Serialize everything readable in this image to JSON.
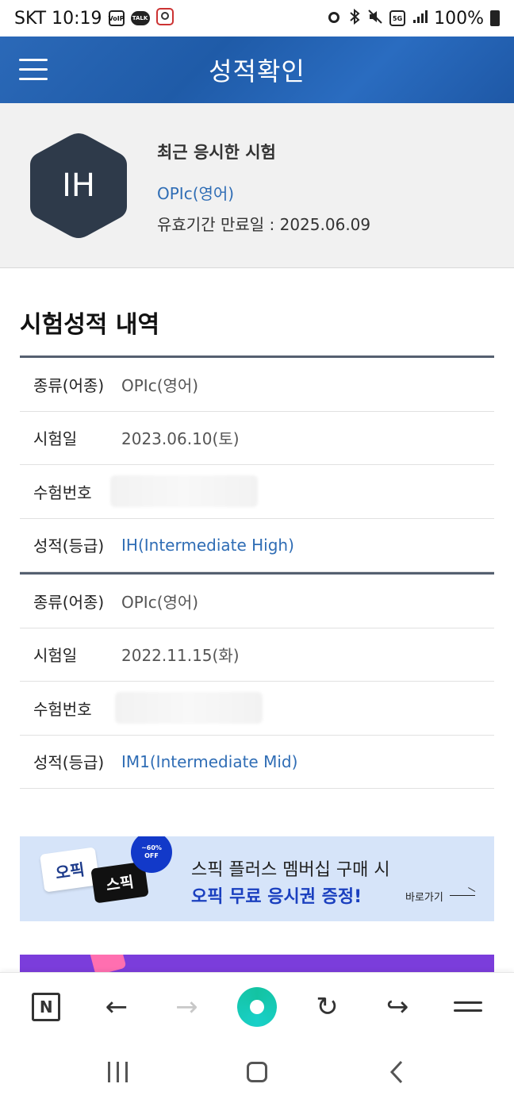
{
  "status_bar": {
    "carrier_time": "SKT 10:19",
    "icons": [
      "voip-icon",
      "talk-icon",
      "location-app-icon",
      "alarm-icon",
      "bluetooth-icon",
      "mute-icon",
      "5g-icon",
      "signal-icon",
      "battery-icon"
    ],
    "voip_label": "VoIP",
    "talk_label": "TALK",
    "network": "5G",
    "battery": "100%"
  },
  "header": {
    "title": "성적확인"
  },
  "profile": {
    "grade_badge": "IH",
    "recent_title": "최근 응시한 시험",
    "recent_exam": "OPIc(영어)",
    "expiry": "유효기간 만료일 : 2025.06.09",
    "badge_color": "#2e3a4a"
  },
  "records_section": {
    "title": "시험성적 내역",
    "records": [
      {
        "type_label": "종류(어종)",
        "type_value": "OPIc(영어)",
        "date_label": "시험일",
        "date_value": "2023.06.10(토)",
        "number_label": "수험번호",
        "grade_label": "성적(등급)",
        "grade_value": "IH(Intermediate High)"
      },
      {
        "type_label": "종류(어종)",
        "type_value": "OPIc(영어)",
        "date_label": "시험일",
        "date_value": "2022.11.15(화)",
        "number_label": "수험번호",
        "grade_label": "성적(등급)",
        "grade_value": "IM1(Intermediate Mid)"
      }
    ]
  },
  "banner": {
    "card1": "오픽",
    "card2": "스픽",
    "badge_top": "~60%",
    "badge_bottom": "OFF",
    "line1": "스픽 플러스 멤버십 구매 시",
    "line2": "오픽 무료 응시권 증정!",
    "link": "바로가기"
  },
  "browser_bar": {
    "home_label": "N",
    "back": "←",
    "forward": "→",
    "refresh": "↻",
    "share": "↪"
  }
}
